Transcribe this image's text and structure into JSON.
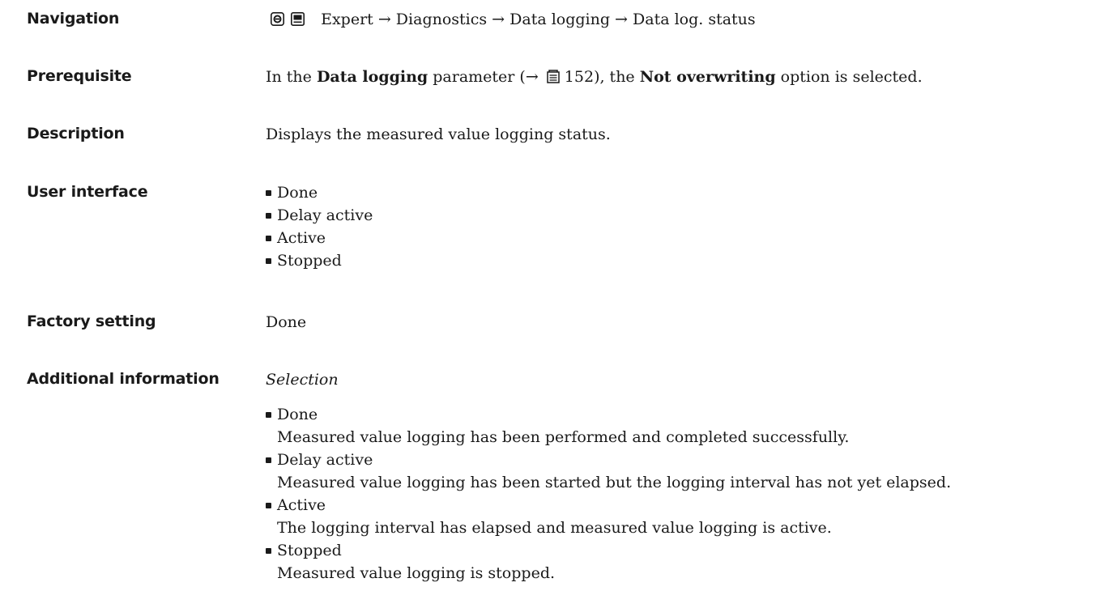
{
  "navigation": {
    "label": "Navigation",
    "path_icons": [
      "operating-menu-icon",
      "display-menu-icon"
    ],
    "path_text": "Expert → Diagnostics → Data logging → Data log. status"
  },
  "prerequisite": {
    "label": "Prerequisite",
    "text_before": "In the ",
    "param_name": "Data logging",
    "text_mid": " parameter (→ ",
    "page_ref": "152",
    "text_after_ref": "), the ",
    "option_name": "Not overwriting",
    "text_end": " option is selected."
  },
  "description": {
    "label": "Description",
    "text": "Displays the measured value logging status."
  },
  "user_interface": {
    "label": "User interface",
    "items": [
      "Done",
      "Delay active",
      "Active",
      "Stopped"
    ]
  },
  "factory_setting": {
    "label": "Factory setting",
    "value": "Done"
  },
  "additional_information": {
    "label": "Additional information",
    "heading": "Selection",
    "items": [
      {
        "name": "Done",
        "desc": "Measured value logging has been performed and completed successfully."
      },
      {
        "name": "Delay active",
        "desc": "Measured value logging has been started but the logging interval has not yet elapsed."
      },
      {
        "name": "Active",
        "desc": "The logging interval has elapsed and measured value logging is active."
      },
      {
        "name": "Stopped",
        "desc": "Measured value logging is stopped."
      }
    ]
  }
}
